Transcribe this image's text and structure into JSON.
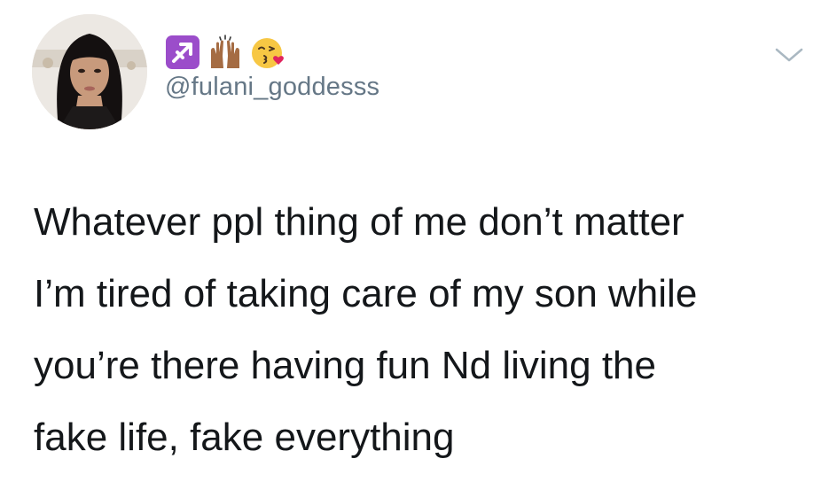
{
  "tweet": {
    "handle": "@fulani_goddesss",
    "display_name_emojis": [
      "sagittarius-icon",
      "raising-hands-icon",
      "face-blowing-kiss-icon"
    ],
    "text_lines": [
      "Whatever ppl thing of me don’t matter",
      "I’m tired of taking care of my son while",
      "you’re there having fun Nd living the",
      "fake life, fake everything"
    ],
    "more_menu_icon": "chevron-down-icon"
  },
  "colors": {
    "text": "#14171a",
    "handle": "#657786",
    "sagittarius_bg": "#9b4dca",
    "chevron": "#aab8c2"
  }
}
